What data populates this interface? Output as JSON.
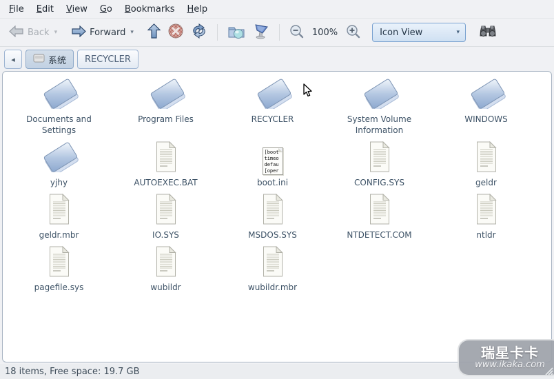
{
  "menu_bar": {
    "items": [
      {
        "key": "F",
        "rest": "ile"
      },
      {
        "key": "E",
        "rest": "dit"
      },
      {
        "key": "V",
        "rest": "iew"
      },
      {
        "key": "G",
        "rest": "o"
      },
      {
        "key": "B",
        "rest": "ookmarks"
      },
      {
        "key": "H",
        "rest": "elp"
      }
    ]
  },
  "toolbar": {
    "back_label": "Back",
    "forward_label": "Forward",
    "back_caret": "▾",
    "forward_caret": "▾",
    "zoom_level": "100%",
    "view_mode": "Icon View",
    "view_caret": "▾"
  },
  "path_bar": {
    "nav_left": "◂",
    "tabs": [
      {
        "label": "系统",
        "active": true
      },
      {
        "label": "RECYCLER",
        "active": false
      }
    ]
  },
  "file_list": [
    {
      "name": "Documents and Settings",
      "type": "folder"
    },
    {
      "name": "Program Files",
      "type": "folder"
    },
    {
      "name": "RECYCLER",
      "type": "folder"
    },
    {
      "name": "System Volume Information",
      "type": "folder"
    },
    {
      "name": "WINDOWS",
      "type": "folder"
    },
    {
      "name": "yjhy",
      "type": "folder"
    },
    {
      "name": "AUTOEXEC.BAT",
      "type": "file"
    },
    {
      "name": "boot.ini",
      "type": "text-preview",
      "preview_lines": [
        "[boot",
        "timeo",
        "defau",
        "[oper"
      ]
    },
    {
      "name": "CONFIG.SYS",
      "type": "file"
    },
    {
      "name": "geldr",
      "type": "file"
    },
    {
      "name": "geldr.mbr",
      "type": "file"
    },
    {
      "name": "IO.SYS",
      "type": "file"
    },
    {
      "name": "MSDOS.SYS",
      "type": "file"
    },
    {
      "name": "NTDETECT.COM",
      "type": "file"
    },
    {
      "name": "ntldr",
      "type": "file"
    },
    {
      "name": "pagefile.sys",
      "type": "file"
    },
    {
      "name": "wubildr",
      "type": "file"
    },
    {
      "name": "wubildr.mbr",
      "type": "file"
    }
  ],
  "status_bar": {
    "text": "18 items, Free space: 19.7 GB"
  },
  "watermark": {
    "brand": "瑞星卡卡",
    "url": "www.ikaka.com"
  },
  "colors": {
    "accent_border": "#7aa2d0",
    "folder_blue": "#8ca8cf",
    "label_text": "#3d5266",
    "status_text": "#3f4d5a",
    "stop_red": "#b55a50"
  }
}
